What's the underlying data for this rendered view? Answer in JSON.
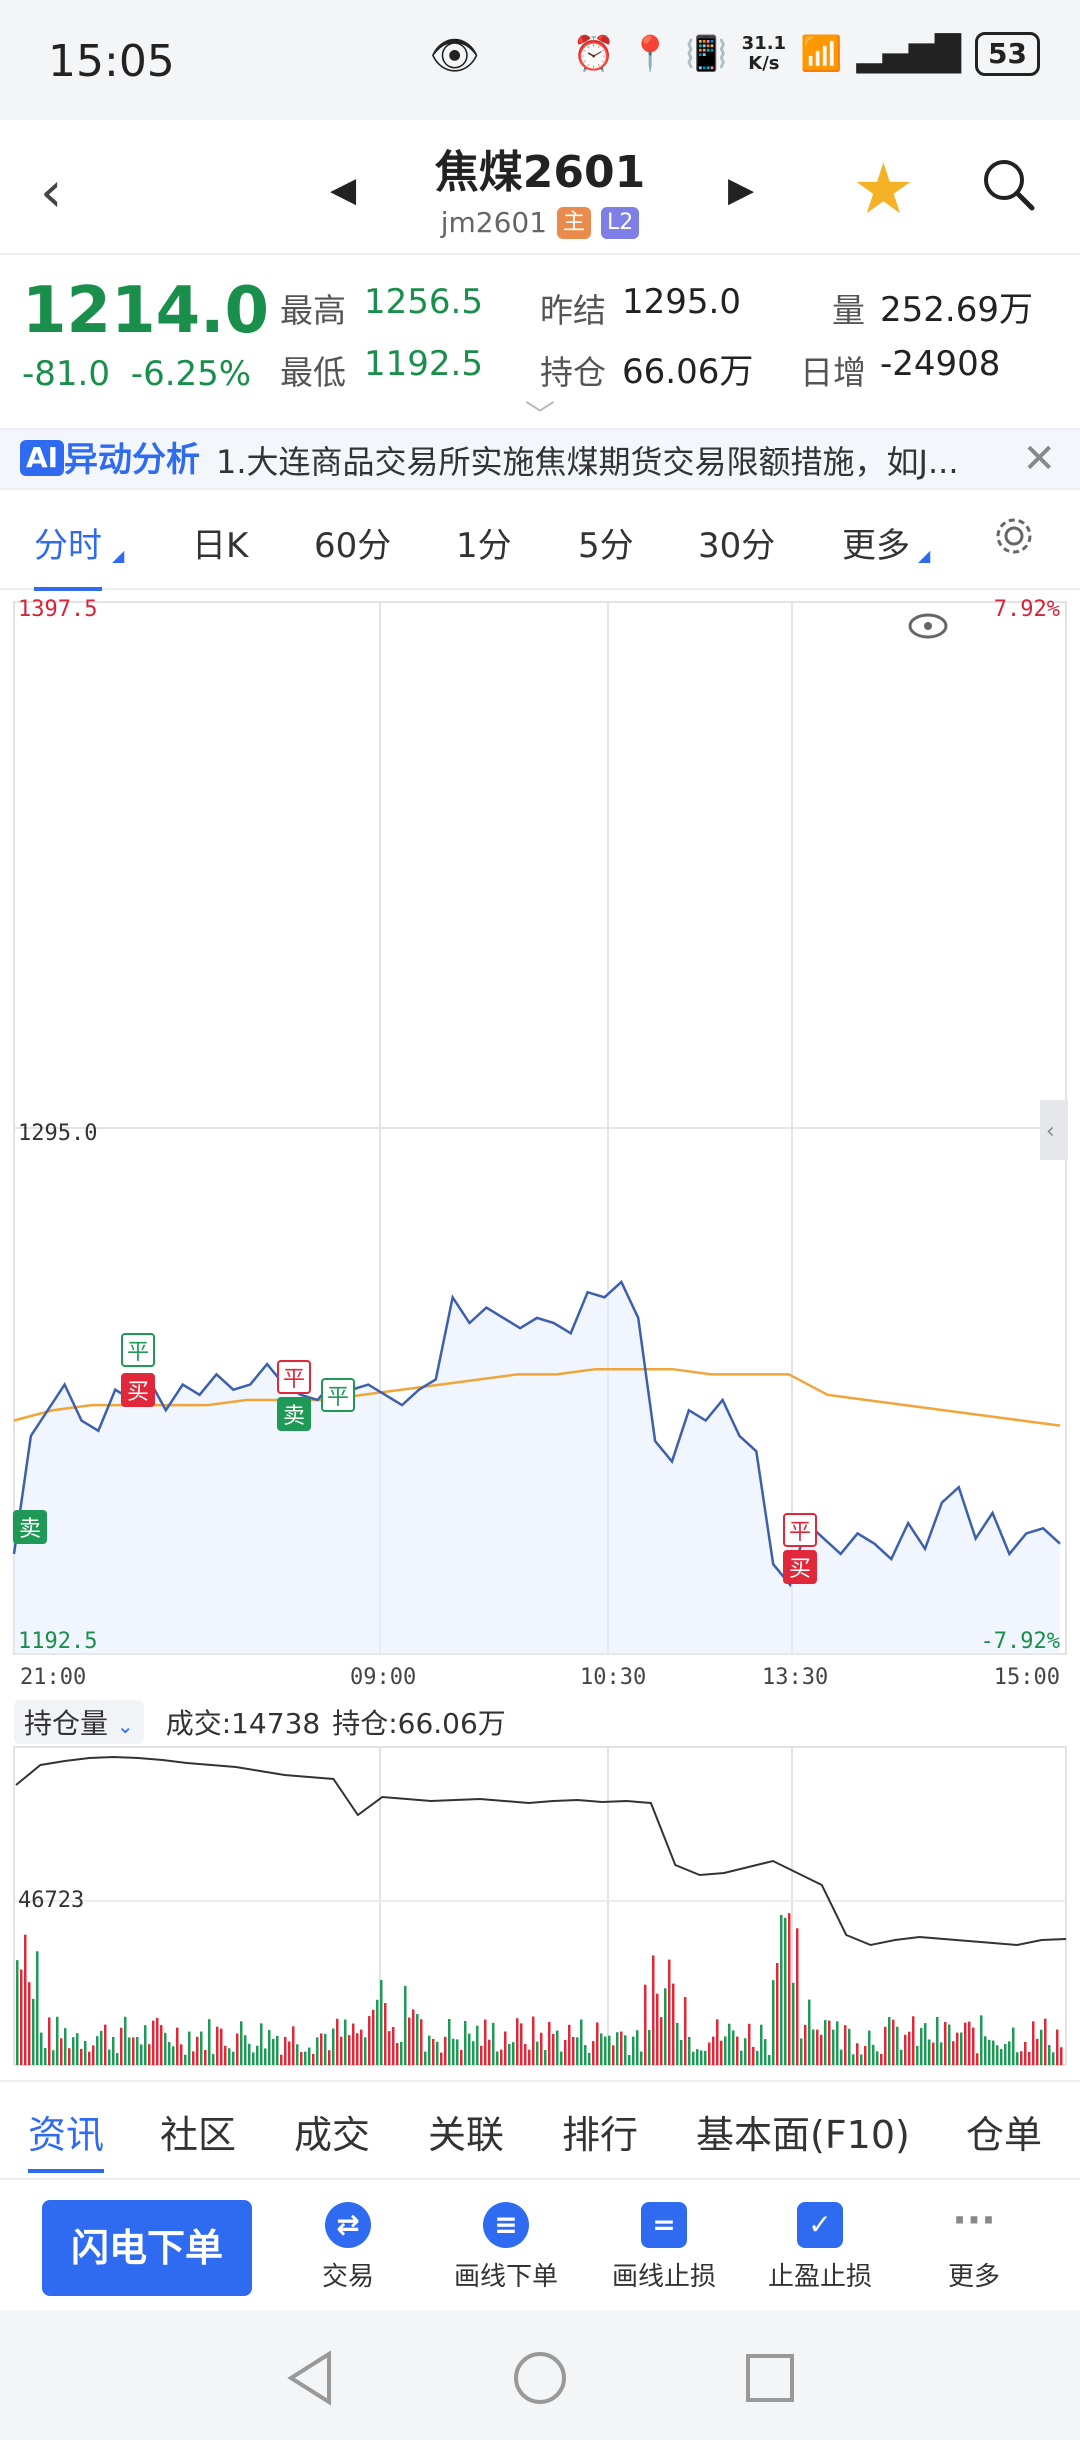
{
  "status": {
    "time": "15:05",
    "net_speed": "31.1\nK/s",
    "battery": "53"
  },
  "header": {
    "title": "焦煤2601",
    "code": "jm2601",
    "badge_main": "主",
    "badge_l2": "L2"
  },
  "quote": {
    "price": "1214.0",
    "change": "-81.0",
    "change_pct": "-6.25%",
    "high_label": "最高",
    "high": "1256.5",
    "low_label": "最低",
    "low": "1192.5",
    "prev_settle_label": "昨结",
    "prev_settle": "1295.0",
    "oi_label": "持仓",
    "oi": "66.06万",
    "vol_label": "量",
    "vol": "252.69万",
    "daily_inc_label": "日增",
    "daily_inc": "-24908"
  },
  "news": {
    "ai": "AI",
    "label": "异动分析",
    "text": "1.大连商品交易所实施焦煤期货交易限额措施，如J..."
  },
  "timeframes": [
    "分时",
    "日K",
    "60分",
    "1分",
    "5分",
    "30分",
    "更多"
  ],
  "chart_data": {
    "type": "line",
    "title": "",
    "y_top_label": "1397.5",
    "y_mid_label": "1295.0",
    "y_bottom_label": "1192.5",
    "pct_top": "7.92%",
    "pct_bottom": "-7.92%",
    "x_labels": [
      "21:00",
      "09:00",
      "10:30",
      "13:30",
      "15:00"
    ],
    "ylim": [
      1192.5,
      1397.5
    ],
    "series": [
      {
        "values": [
          1212,
          1235,
          1240,
          1245,
          1238,
          1236,
          1244,
          1242,
          1246,
          1240,
          1245,
          1243,
          1247,
          1244,
          1245,
          1249,
          1245,
          1243,
          1242,
          1246,
          1244,
          1245,
          1243,
          1241,
          1244,
          1246,
          1262,
          1257,
          1260,
          1258,
          1256,
          1258,
          1257,
          1255,
          1263,
          1262,
          1265,
          1258,
          1234,
          1230,
          1240,
          1238,
          1242,
          1235,
          1232,
          1210,
          1206,
          1218,
          1215,
          1212,
          1216,
          1214,
          1211,
          1218,
          1213,
          1222,
          1225,
          1215,
          1220,
          1212,
          1216,
          1217,
          1214
        ]
      },
      {
        "values": [
          1238,
          1240,
          1241,
          1241,
          1241,
          1241,
          1242,
          1242,
          1242,
          1243,
          1244,
          1245,
          1246,
          1247,
          1247,
          1248,
          1248,
          1248,
          1247,
          1247,
          1247,
          1243,
          1242,
          1241,
          1240,
          1239,
          1238,
          1237
        ]
      }
    ],
    "markers": [
      {
        "text": "卖",
        "color": "#1f9a56"
      },
      {
        "text": "平",
        "color": "#1f9a56"
      },
      {
        "text": "买",
        "color": "#e0283a"
      },
      {
        "text": "平",
        "color": "#e0283a"
      },
      {
        "text": "卖",
        "color": "#1f9a56"
      },
      {
        "text": "平",
        "color": "#1f9a56"
      },
      {
        "text": "平",
        "color": "#e0283a"
      },
      {
        "text": "买",
        "color": "#e0283a"
      }
    ]
  },
  "volume": {
    "selector": "持仓量",
    "deal": "成交:14738",
    "oi": "持仓:66.06万",
    "mid_label": "46723",
    "oi_curve": [
      30,
      10,
      6,
      3,
      2,
      3,
      5,
      8,
      10,
      12,
      16,
      20,
      22,
      24,
      60,
      42,
      44,
      46,
      45,
      44,
      46,
      48,
      46,
      45,
      47,
      46,
      48,
      110,
      120,
      118,
      112,
      106,
      118,
      130,
      180,
      190,
      185,
      182,
      184,
      186,
      188,
      190,
      185,
      184
    ]
  },
  "info_tabs": [
    "资讯",
    "社区",
    "成交",
    "关联",
    "排行",
    "基本面(F10)",
    "仓单"
  ],
  "actions": {
    "flash": "闪电下单",
    "items": [
      "交易",
      "画线下单",
      "画线止损",
      "止盈止损",
      "更多"
    ]
  }
}
